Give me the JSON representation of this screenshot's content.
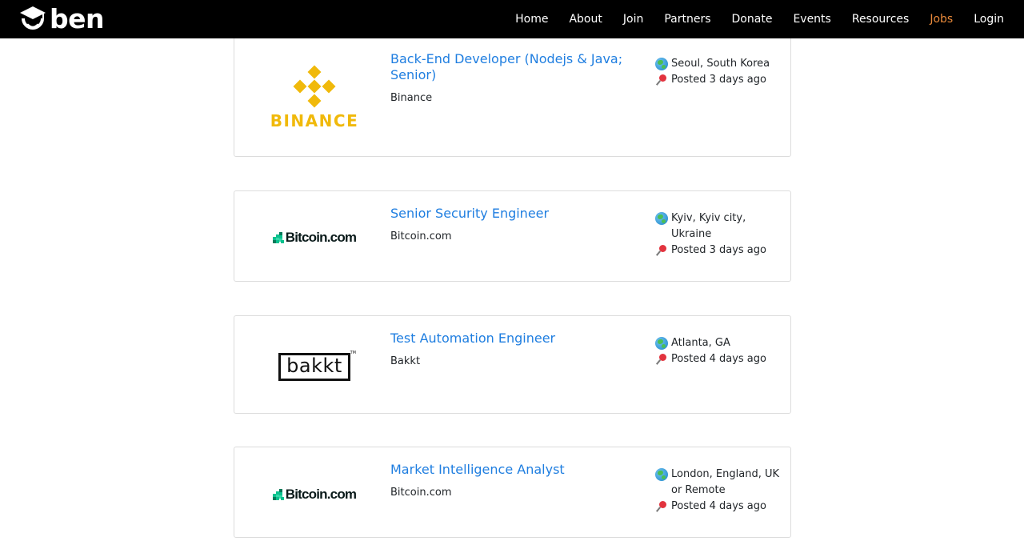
{
  "navbar": {
    "brand": "ben",
    "links": [
      {
        "label": "Home"
      },
      {
        "label": "About"
      },
      {
        "label": "Join"
      },
      {
        "label": "Partners"
      },
      {
        "label": "Donate"
      },
      {
        "label": "Events"
      },
      {
        "label": "Resources"
      },
      {
        "label": "Jobs",
        "active": true
      },
      {
        "label": "Login"
      }
    ],
    "colors": {
      "background": "#000000",
      "text": "#ffffff",
      "active": "#e8893a"
    }
  },
  "jobs": [
    {
      "title": "Back-End Developer (Nodejs & Java; Senior)",
      "company": "Binance",
      "location": "Seoul, South Korea",
      "posted": "Posted 3 days ago",
      "logo": {
        "text": "BINANCE",
        "icon": "binance-diamond-icon",
        "color": "#f0b90b"
      }
    },
    {
      "title": "Senior Security Engineer",
      "company": "Bitcoin.com",
      "location": "Kyiv, Kyiv city, Ukraine",
      "posted": "Posted 3 days ago",
      "logo": {
        "text": "Bitcoin.com",
        "icon": "bitcoin-com-cubes-icon",
        "color": "#0ac18e"
      }
    },
    {
      "title": "Test Automation Engineer",
      "company": "Bakkt",
      "location": "Atlanta, GA",
      "posted": "Posted 4 days ago",
      "logo": {
        "text": "bakkt",
        "tm": "TM",
        "color": "#111111"
      }
    },
    {
      "title": "Market Intelligence Analyst",
      "company": "Bitcoin.com",
      "location": "London, England, UK or Remote",
      "posted": "Posted 4 days ago",
      "logo": {
        "text": "Bitcoin.com",
        "icon": "bitcoin-com-cubes-icon",
        "color": "#0ac18e"
      }
    }
  ],
  "icons": {
    "location": "globe-icon",
    "posted": "pushpin-icon"
  },
  "colors": {
    "job_title": "#1f7ee0",
    "card_border": "#dcdcdc"
  }
}
